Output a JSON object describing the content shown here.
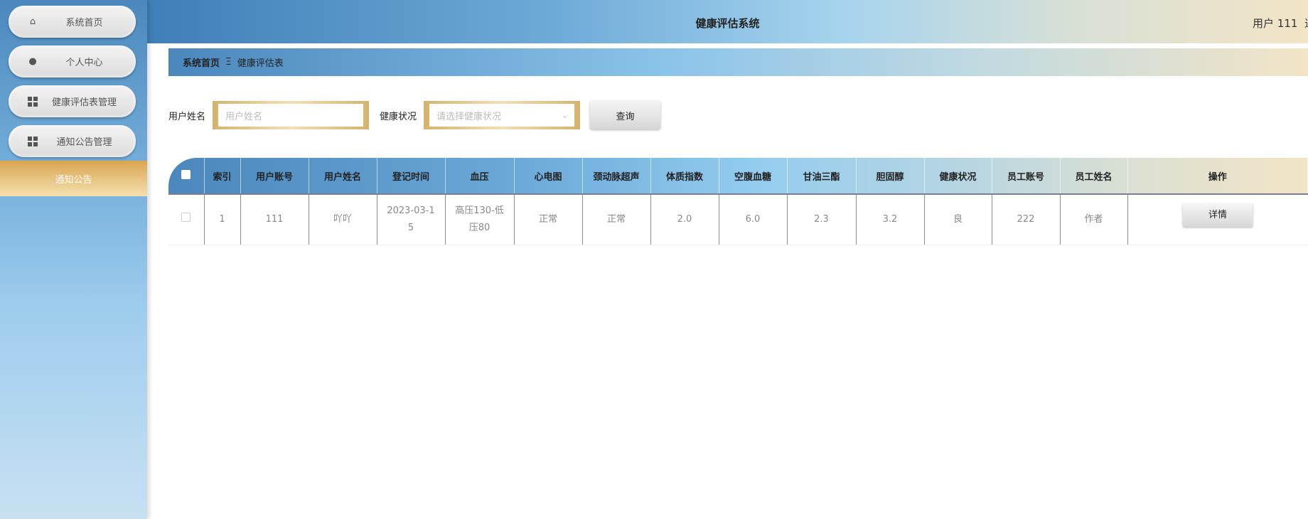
{
  "sidebar": {
    "items": [
      {
        "label": "系统首页",
        "icon": "home-icon"
      },
      {
        "label": "个人中心",
        "icon": "user-icon"
      },
      {
        "label": "健康评估表管理",
        "icon": "grid-icon"
      },
      {
        "label": "通知公告管理",
        "icon": "grid-icon"
      }
    ],
    "active": "通知公告"
  },
  "header": {
    "title": "健康评估系统",
    "user": "用户 111",
    "logout": "退"
  },
  "breadcrumb": {
    "home": "系统首页",
    "sep": "Ξ",
    "current": "健康评估表"
  },
  "search": {
    "name_label": "用户姓名",
    "name_placeholder": "用户姓名",
    "status_label": "健康状况",
    "status_placeholder": "请选择健康状况",
    "query": "查询"
  },
  "table": {
    "headers": [
      "索引",
      "用户账号",
      "用户姓名",
      "登记时间",
      "血压",
      "心电图",
      "颈动脉超声",
      "体质指数",
      "空腹血糖",
      "甘油三酯",
      "胆固醇",
      "健康状况",
      "员工账号",
      "员工姓名",
      "操作"
    ],
    "rows": [
      {
        "cells": [
          "1",
          "111",
          "吖吖",
          "2023-03-15",
          "高压130-低压80",
          "正常",
          "正常",
          "2.0",
          "6.0",
          "2.3",
          "3.2",
          "良",
          "222",
          "作者"
        ],
        "action": "详情"
      }
    ]
  }
}
